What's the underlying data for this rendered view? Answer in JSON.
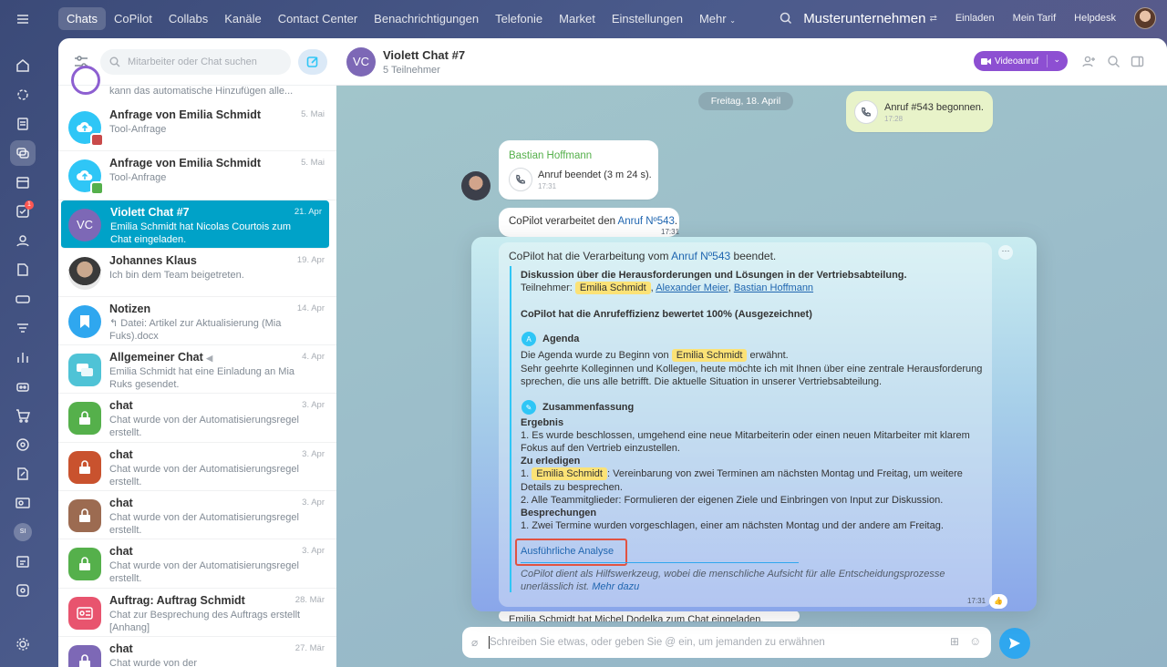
{
  "nav": {
    "items": [
      "Chats",
      "CoPilot",
      "Collabs",
      "Kanäle",
      "Contact Center",
      "Benachrichtigungen",
      "Telefonie",
      "Market",
      "Einstellungen",
      "Mehr"
    ],
    "company": "Musterunternehmen",
    "invite": "Einladen",
    "tariff": "Mein Tarif",
    "helpdesk": "Helpdesk"
  },
  "leftbar": {
    "badge": "1",
    "user_initials": "SI"
  },
  "chatlist": {
    "search_placeholder": "Mitarbeiter oder Chat suchen",
    "peek_text": "kann das automatische Hinzufügen alle...",
    "items": [
      {
        "title": "Anfrage von Emilia Schmidt",
        "date": "5. Mai",
        "msg": "Tool-Anfrage"
      },
      {
        "title": "Anfrage von Emilia Schmidt",
        "date": "5. Mai",
        "msg": "Tool-Anfrage"
      },
      {
        "title": "Violett Chat #7",
        "date": "21. Apr",
        "msg": "Emilia Schmidt hat Nicolas Courtois zum Chat eingeladen.",
        "initials": "VC"
      },
      {
        "title": "Johannes Klaus",
        "date": "19. Apr",
        "msg": "Ich bin dem Team beigetreten."
      },
      {
        "title": "Notizen",
        "date": "14. Apr",
        "msg": "↰ Datei: Artikel zur Aktualisierung (Mia Fuks).docx"
      },
      {
        "title": "Allgemeiner Chat",
        "date": "4. Apr",
        "msg": "Emilia Schmidt hat eine Einladung an Mia Ruks gesendet."
      },
      {
        "title": "chat",
        "date": "3. Apr",
        "msg": "Chat wurde von der Automatisierungsregel erstellt."
      },
      {
        "title": "chat",
        "date": "3. Apr",
        "msg": "Chat wurde von der Automatisierungsregel erstellt."
      },
      {
        "title": "chat",
        "date": "3. Apr",
        "msg": "Chat wurde von der Automatisierungsregel erstellt."
      },
      {
        "title": "chat",
        "date": "3. Apr",
        "msg": "Chat wurde von der Automatisierungsregel erstellt."
      },
      {
        "title": "Auftrag: Auftrag Schmidt",
        "date": "28. Mär",
        "msg": "Chat zur Besprechung des Auftrags erstellt [Anhang]"
      },
      {
        "title": "chat",
        "date": "27. Mär",
        "msg": "Chat wurde von der"
      }
    ]
  },
  "header": {
    "initials": "VC",
    "title": "Violett Chat #7",
    "subtitle": "5 Teilnehmer",
    "video_label": "Videoanruf"
  },
  "messages": {
    "date": "Freitag, 18. April",
    "call_started": {
      "text": "Anruf #543 begonnen.",
      "time": "17:28"
    },
    "bastian": {
      "name": "Bastian Hoffmann",
      "text": "Anruf beendet (3 m 24 s).",
      "time": "17:31"
    },
    "copilot_processing": {
      "prefix": "CoPilot verarbeitet den ",
      "link": "Anruf Nº543",
      "suffix": ".",
      "time": "17:31"
    }
  },
  "result": {
    "intro_prefix": "CoPilot hat die Verarbeitung vom ",
    "intro_link": "Anruf Nº543",
    "intro_suffix": " beendet.",
    "discussion": "Diskussion über die Herausforderungen und Lösungen in der Vertriebsabteilung.",
    "participants_label": "Teilnehmer:",
    "participants": [
      "Emilia Schmidt",
      "Alexander Meier",
      "Bastian Hoffmann"
    ],
    "efficiency": "CoPilot hat die Anrufeffizienz bewertet 100% (Ausgezeichnet)",
    "agenda_title": "Agenda",
    "agenda_prefix": "Die Agenda wurde zu Beginn von ",
    "agenda_person": "Emilia Schmidt",
    "agenda_suffix": " erwähnt.",
    "agenda_line2": "Sehr geehrte Kolleginnen und Kollegen, heute möchte ich mit Ihnen über eine zentrale Herausforderung",
    "agenda_line3": "sprechen, die uns alle betrifft. Die aktuelle Situation in unserer Vertriebsabteilung.",
    "summary_title": "Zusammenfassung",
    "result_title": "Ergebnis",
    "result_line1": "1. Es wurde beschlossen, umgehend eine neue Mitarbeiterin oder einen neuen Mitarbeiter mit klarem",
    "result_line2": "Fokus auf den Vertrieb einzustellen.",
    "todo_title": "Zu erledigen",
    "todo1_prefix": "1. ",
    "todo1_person": "Emilia Schmidt",
    "todo1_suffix": ": Vereinbarung von zwei Terminen am nächsten Montag und Freitag, um weitere",
    "todo1_line2": "Details zu besprechen.",
    "todo2": "2. Alle Teammitglieder: Formulieren der eigenen Ziele und Einbringen von Input zur Diskussion.",
    "meetings_title": "Besprechungen",
    "meetings1": "1. Zwei Termine wurden vorgeschlagen, einer am nächsten Montag und der andere am Freitag.",
    "detail_link": "Ausführliche Analyse",
    "disclaimer1": "CoPilot dient als Hilfswerkzeug, wobei die menschliche Aufsicht für alle Entscheidungsprozesse",
    "disclaimer2_prefix": "unerlässlich ist. ",
    "more_link": "Mehr dazu",
    "time": "17:31"
  },
  "behind_text": "Emilia Schmidt hat Michel Dodelka zum Chat eingeladen.",
  "input": {
    "placeholder": "Schreiben Sie etwas, oder geben Sie @ ein, um jemanden zu erwähnen"
  },
  "colors": {
    "accent": "#2fc6f6",
    "selected": "#00a2c8",
    "video": "#8d4fd2",
    "highlight": "#fbe276",
    "redbox": "#e15241"
  }
}
